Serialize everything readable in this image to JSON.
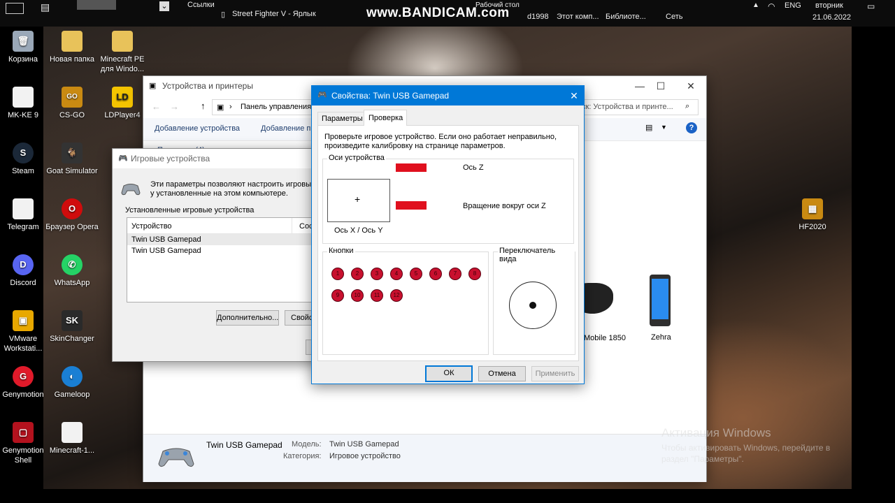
{
  "topbar": {
    "links": "Ссылки",
    "shortcut": "Street Fighter V - Ярлык",
    "watermark": "www.BANDICAM.com",
    "desktop_label": "Рабочий стол",
    "user": "d1998",
    "this_pc": "Этот комп...",
    "libraries": "Библиоте...",
    "network": "Сеть",
    "lang": "ENG",
    "day": "вторник",
    "date": "21.06.2022"
  },
  "desktop_icons": [
    {
      "label": "Корзина"
    },
    {
      "label": "Новая папка"
    },
    {
      "label": "Minecraft PE для Windo..."
    },
    {
      "label": "MK-KE 9"
    },
    {
      "label": "CS-GO"
    },
    {
      "label": "LDPlayer4"
    },
    {
      "label": "Steam"
    },
    {
      "label": "Goat Simulator"
    },
    {
      "label": "Telegram"
    },
    {
      "label": "Браузер Opera"
    },
    {
      "label": "Discord"
    },
    {
      "label": "WhatsApp"
    },
    {
      "label": "VMware Workstati..."
    },
    {
      "label": "SkinChanger"
    },
    {
      "label": "Genymotion"
    },
    {
      "label": "Gameloop"
    },
    {
      "label": "Genymotion Shell"
    },
    {
      "label": "Minecraft-1..."
    },
    {
      "label": "HF2020"
    }
  ],
  "devices_window": {
    "title": "Устройства и принтеры",
    "address": "Панель управления",
    "search_placeholder": "ск: Устройства и принте...",
    "cmd_add": "Добавление устройства",
    "cmd_add2": "Добавление п",
    "section": "Принтеры (4)",
    "device_mobile": "Mobile 1850",
    "device_zehra": "Zehra",
    "details_name": "Twin USB Gamepad",
    "details_model_label": "Модель:",
    "details_model_value": "Twin USB Gamepad",
    "details_category_label": "Категория:",
    "details_category_value": "Игровое устройство"
  },
  "game_controllers": {
    "title": "Игровые устройства",
    "description": "Эти параметры позволяют настроить игровые у установленные на этом компьютере.",
    "list_label": "Установленные игровые устройства",
    "col_device": "Устройство",
    "col_status": "Сос",
    "rows": [
      "Twin USB Gamepad",
      "Twin USB Gamepad"
    ],
    "btn_advanced": "Дополнительно...",
    "btn_props": "Свойс"
  },
  "props_dialog": {
    "title": "Свойства: Twin USB Gamepad",
    "tabs": [
      "Параметры",
      "Проверка"
    ],
    "instructions": "Проверьте игровое устройство. Если оно работает неправильно, произведите калибровку на странице параметров.",
    "axes_group": "Оси устройства",
    "axis_z": "Ось Z",
    "axis_rz": "Вращение вокруг оси Z",
    "axis_xy": "Ось X / Ось Y",
    "buttons_group": "Кнопки",
    "buttons": [
      "1",
      "2",
      "3",
      "4",
      "5",
      "6",
      "7",
      "8",
      "9",
      "10",
      "11",
      "12"
    ],
    "pov_group": "Переключатель вида",
    "ok": "ОК",
    "cancel": "Отмена",
    "apply": "Применить",
    "accent_color": "#0078d7",
    "bar_color": "#e0101e"
  },
  "activation": {
    "title": "Активация Windows",
    "line1": "Чтобы активировать Windows, перейдите в",
    "line2": "раздел \"Параметры\"."
  }
}
